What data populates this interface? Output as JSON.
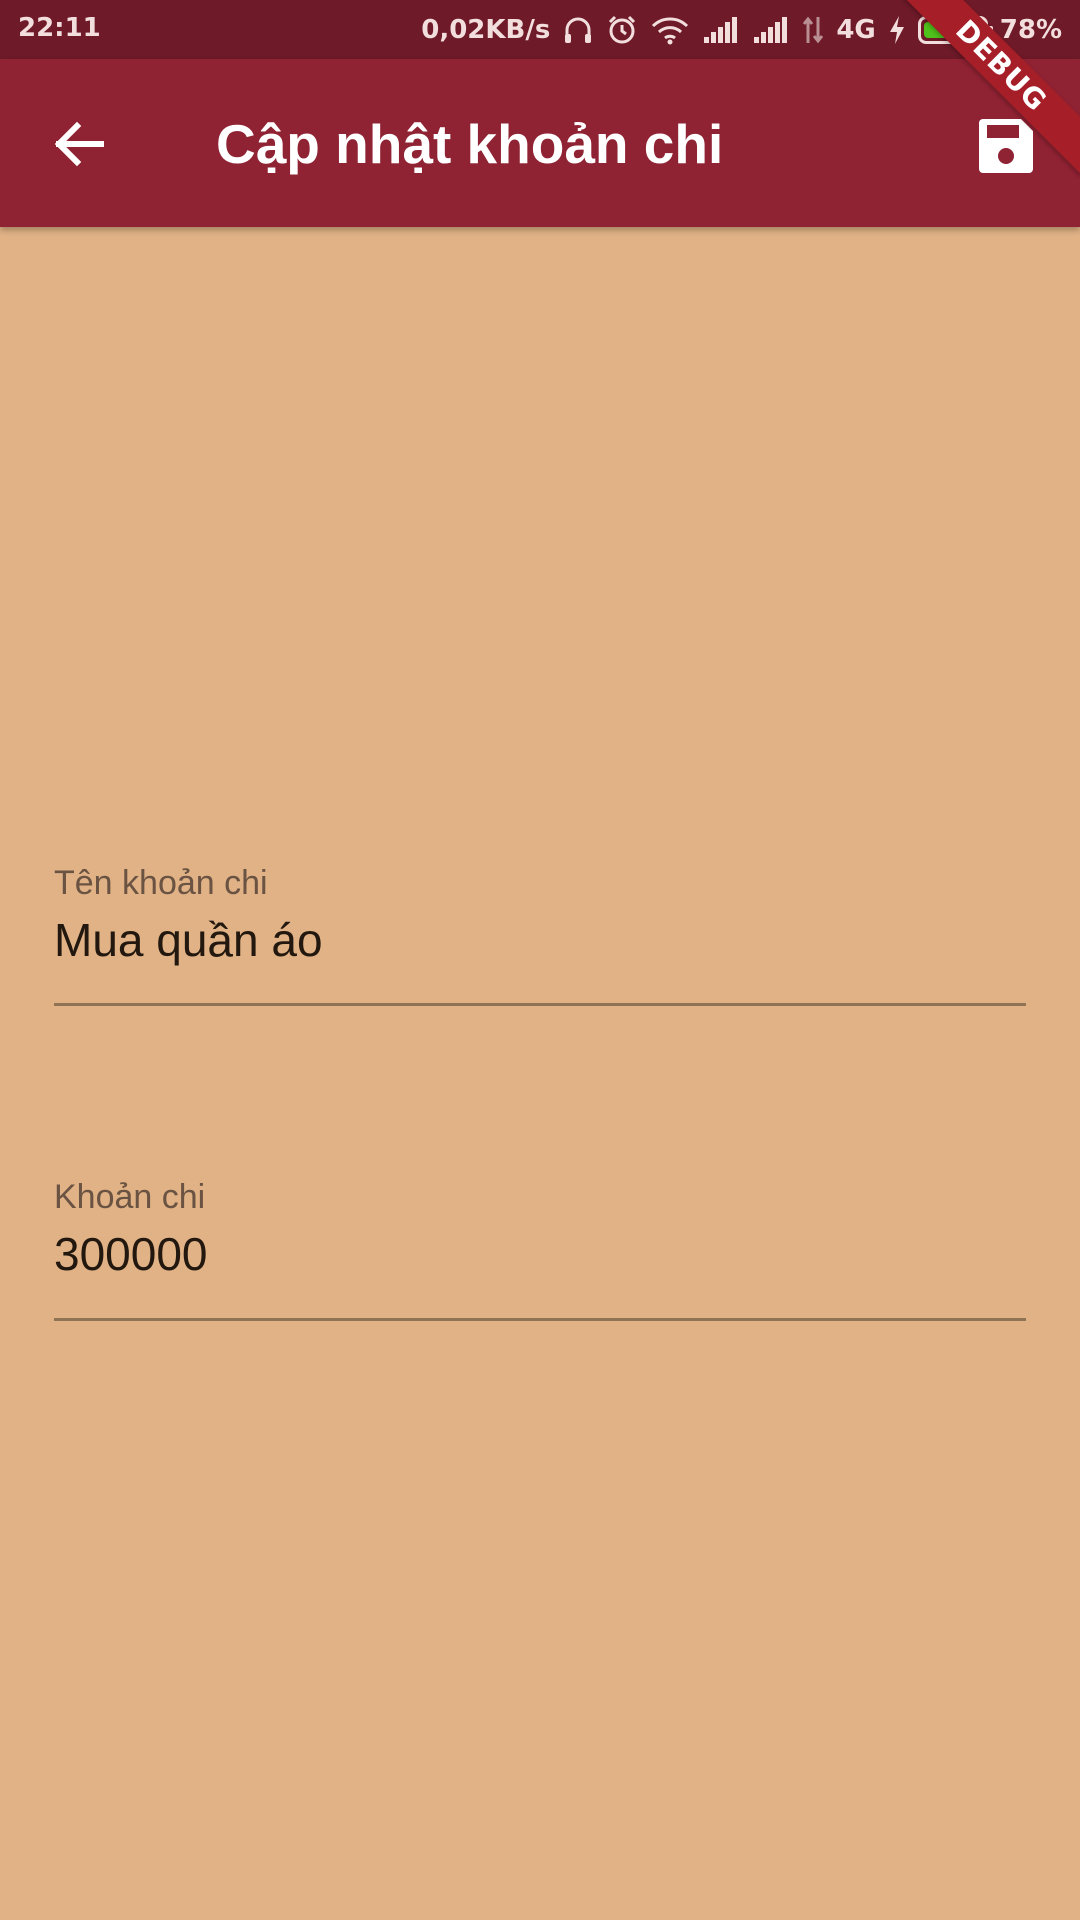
{
  "status_bar": {
    "time": "22:11",
    "network_speed": "0,02KB/s",
    "network_type": "4G",
    "battery_percent": "78%",
    "battery_level": 0.78,
    "battery_color": "#4fc21b",
    "icons": [
      "headset-icon",
      "alarm-icon",
      "wifi-icon",
      "signal-1-icon",
      "signal-2-icon",
      "data-arrows-icon",
      "charging-icon",
      "battery-icon"
    ]
  },
  "app_bar": {
    "title": "Cập nhật khoản chi",
    "back_icon": "arrow-back-icon",
    "save_icon": "save-icon",
    "background": "#8f2233"
  },
  "debug_banner": {
    "label": "DEBUG"
  },
  "form": {
    "name_field": {
      "label": "Tên khoản chi",
      "value": "Mua quần áo"
    },
    "amount_field": {
      "label": "Khoản chi",
      "value": "300000"
    }
  },
  "colors": {
    "background": "#e0b285",
    "status_bar": "#6e1a28"
  }
}
